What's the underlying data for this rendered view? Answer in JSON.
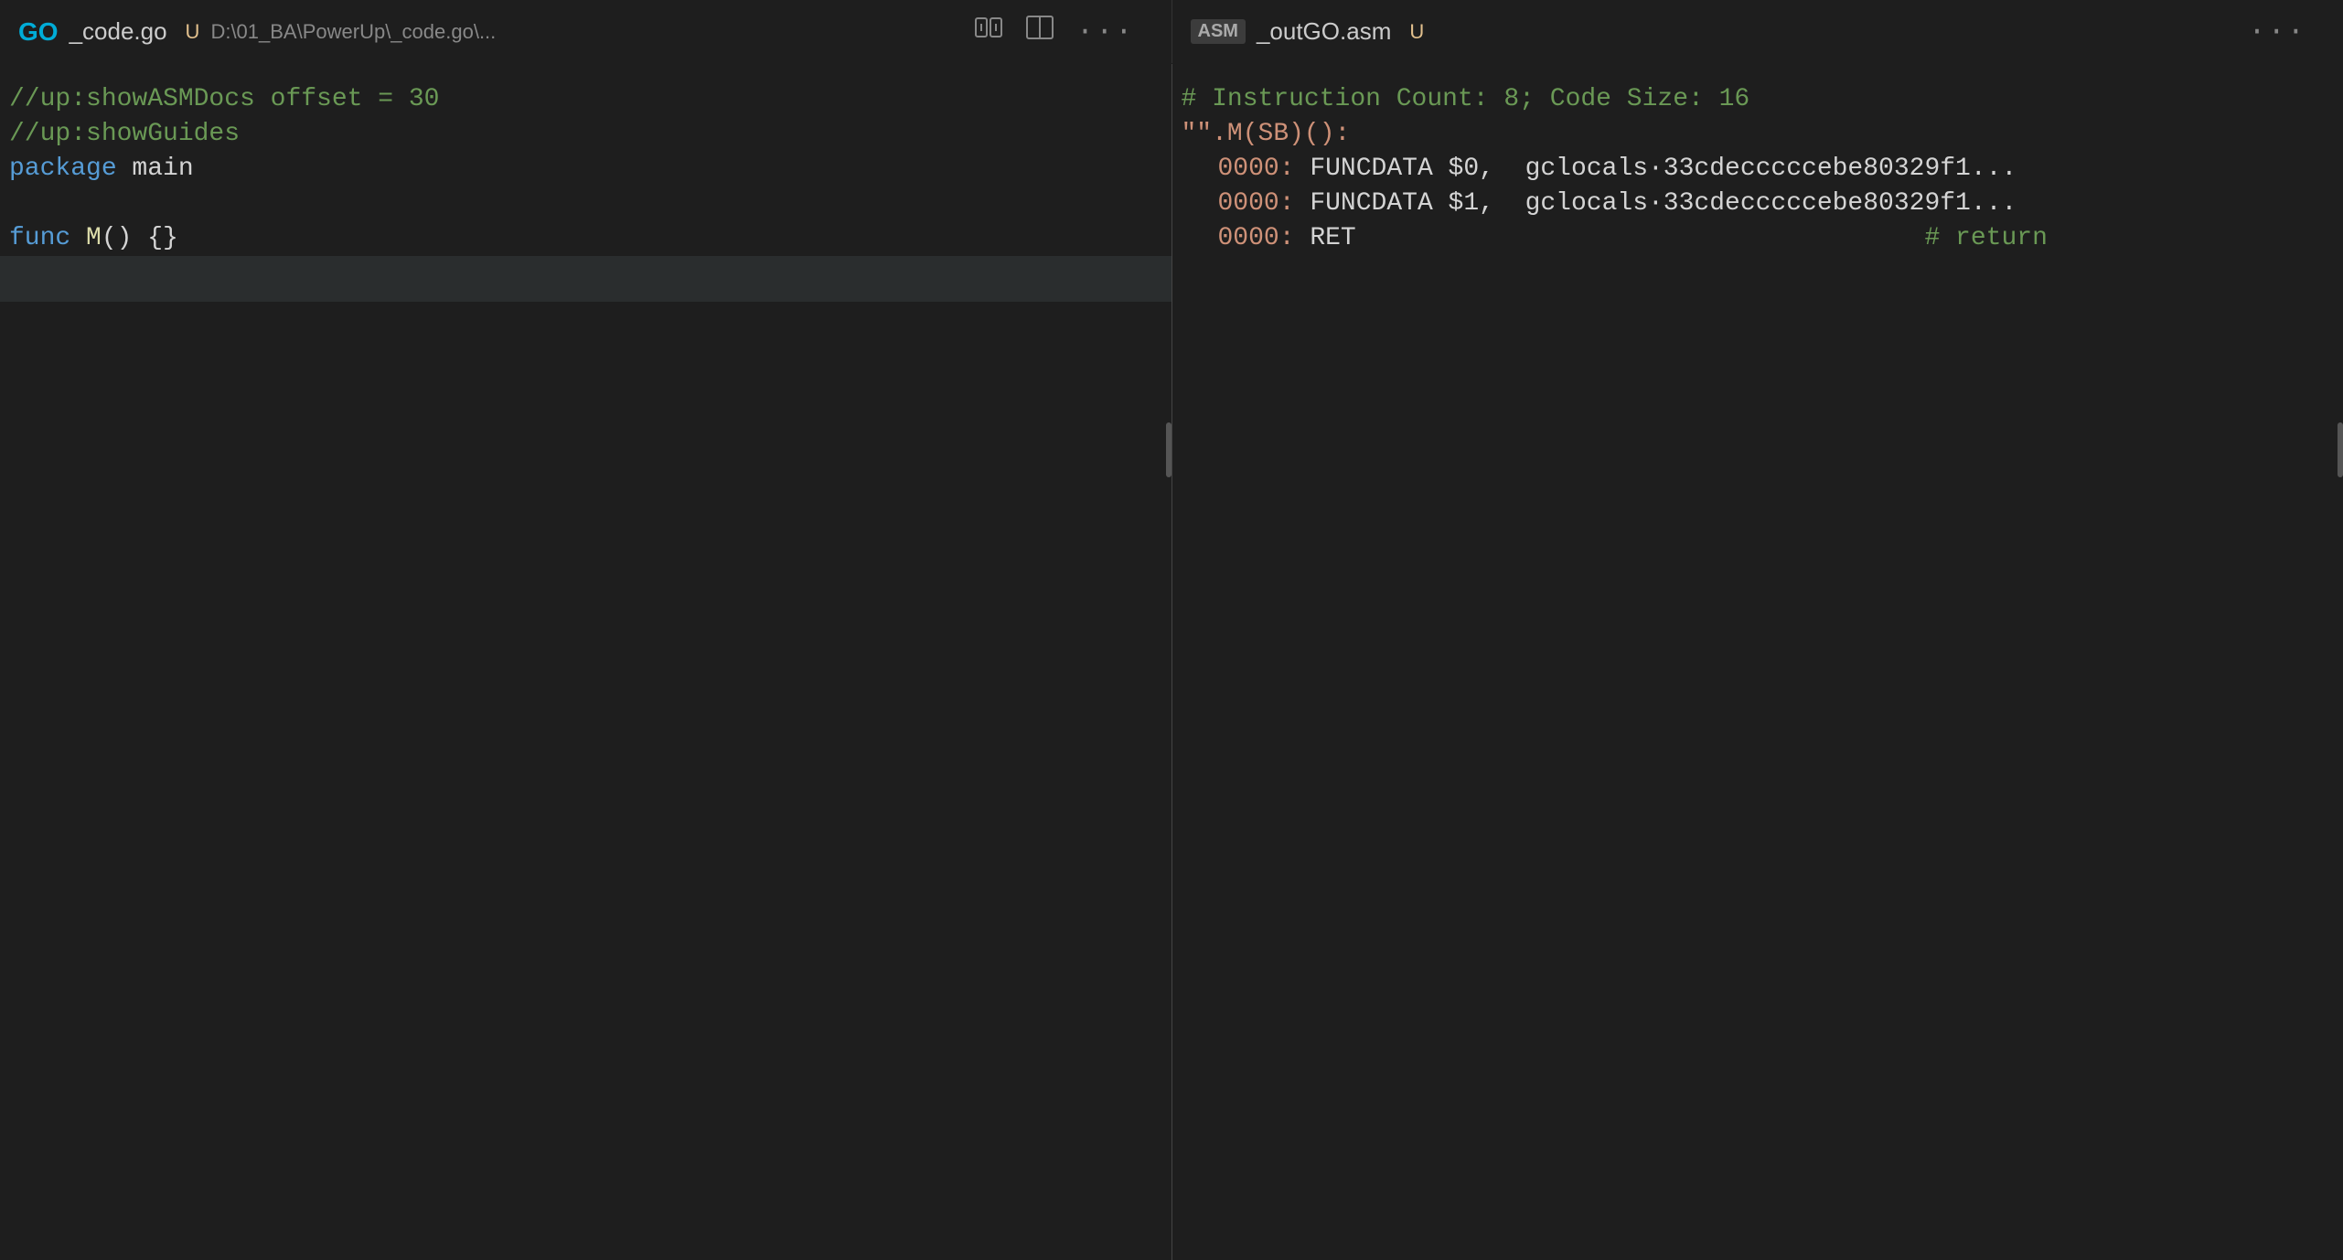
{
  "colors": {
    "bg": "#1e1e1e",
    "tabBg": "#252526",
    "activeBg": "#1e1e1e",
    "border": "#444",
    "scrollThumb": "#555"
  },
  "leftPane": {
    "tab": {
      "icon": "GO",
      "filename": "_code.go",
      "badge": "U",
      "path": "D:\\01_BA\\PowerUp\\_code.go\\..."
    },
    "actions": {
      "compare": "⇄",
      "split": "⧉",
      "more": "···"
    },
    "lines": [
      {
        "content": "//up:showASMDocs offset = 30",
        "type": "comment"
      },
      {
        "content": "//up:showGuides",
        "type": "comment"
      },
      {
        "content": "package main",
        "type": "code"
      },
      {
        "content": "",
        "type": "empty"
      },
      {
        "content": "func M() {}",
        "type": "code"
      }
    ]
  },
  "rightPane": {
    "tab": {
      "icon": "ASM",
      "filename": "_outGO.asm",
      "badge": "U"
    },
    "actions": {
      "more": "···"
    },
    "lines": [
      {
        "content": "# Instruction Count: 8; Code Size: 16",
        "type": "comment"
      },
      {
        "content": "\"\".M(SB)():",
        "type": "label"
      },
      {
        "content": "\t0000:\tFUNCDATA $0,\tgclocals·33cdecccccebe80329f1...",
        "type": "asm",
        "address": "0000:",
        "mnemonic": "FUNCDATA",
        "operand": "$0,",
        "extra": "\tgclocals·33cdecccccebe80329f1..."
      },
      {
        "content": "\t0000:\tFUNCDATA $1,\tgclocals·33cdecccccebe80329f1...",
        "type": "asm",
        "address": "0000:",
        "mnemonic": "FUNCDATA",
        "operand": "$1,",
        "extra": "\tgclocals·33cdecccccebe80329f1..."
      },
      {
        "content": "\t0000:\tRET\t\t\t# return",
        "type": "asm_ret",
        "address": "0000:",
        "mnemonic": "RET",
        "comment": "# return"
      }
    ]
  }
}
